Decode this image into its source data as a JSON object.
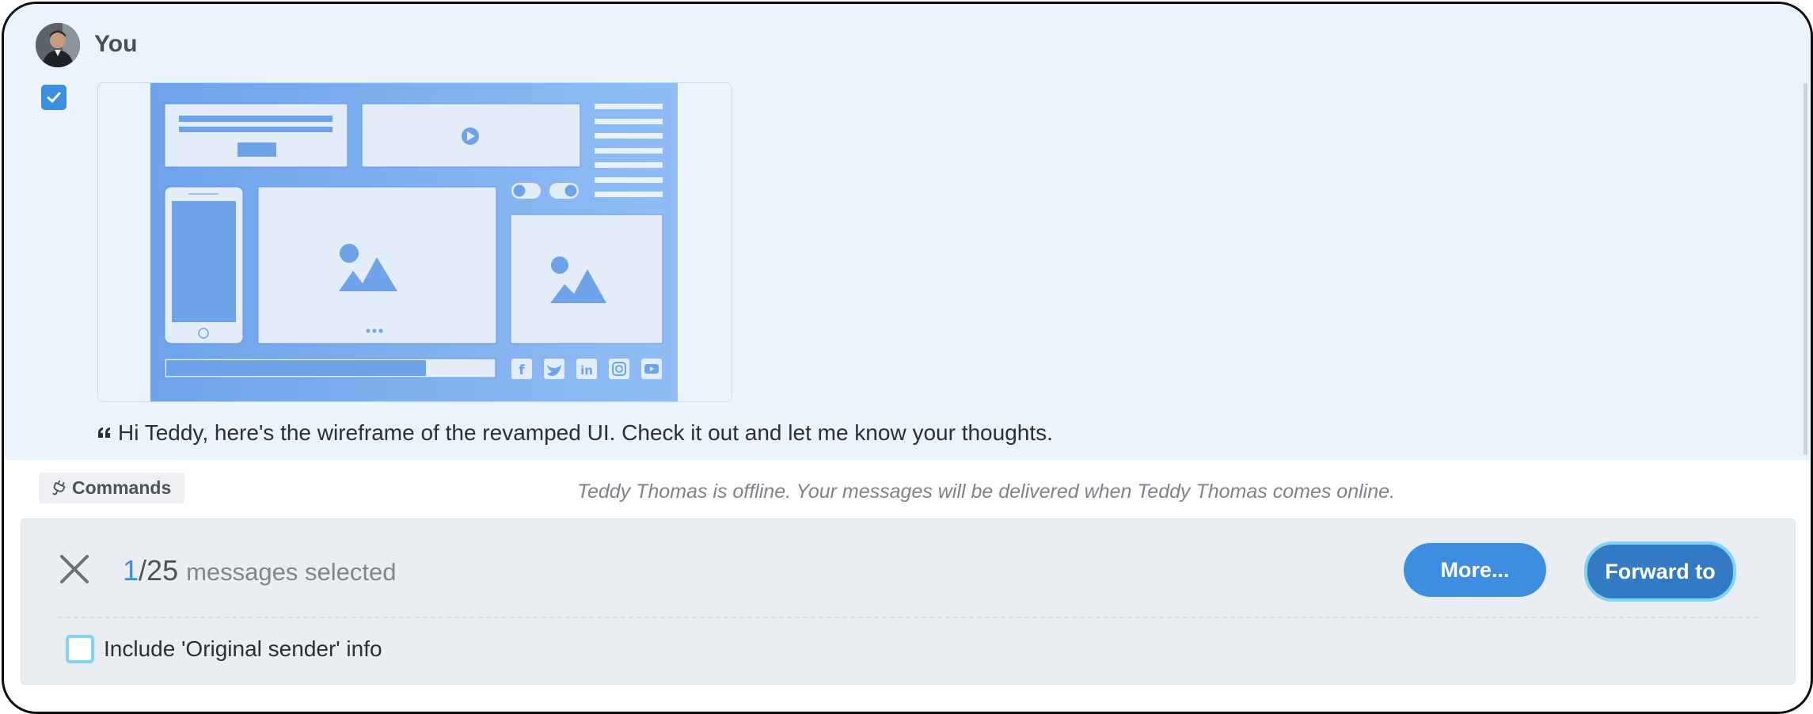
{
  "message": {
    "sender": "You",
    "selected": true,
    "attachment_icon": "wireframe-image",
    "caption_icon": "quote-icon",
    "caption": "Hi Teddy, here's the wireframe of the revamped UI. Check it out and let me know your thoughts."
  },
  "composer": {
    "commands_label": "Commands",
    "commands_icon": "plug-icon",
    "offline_notice": "Teddy Thomas is offline. Your messages will be delivered when Teddy Thomas comes online."
  },
  "selection": {
    "close_icon": "close-icon",
    "count": "1",
    "separator": "/",
    "total": "25",
    "label": "messages selected",
    "more_label": "More...",
    "forward_label": "Forward to",
    "include_original_label": "Include 'Original sender' info",
    "include_original_checked": false
  },
  "colors": {
    "accent": "#3b8ee0",
    "forward_button": "#3479c4",
    "focus_ring": "#7fd4f5",
    "message_bg": "#ebf3fc",
    "panel_bg": "#eaedf1"
  }
}
